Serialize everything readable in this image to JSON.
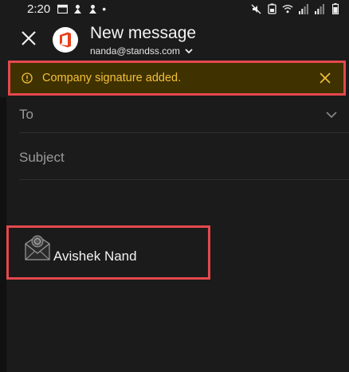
{
  "status_bar": {
    "time": "2:20",
    "dot": "•",
    "left_icons": [
      "calendar-icon",
      "notification-icon",
      "notification-icon",
      "dot"
    ],
    "right_icons": [
      "mute-icon",
      "data-saver-icon",
      "wifi-icon",
      "signal-icon",
      "signal-icon",
      "battery-icon"
    ]
  },
  "header": {
    "close_icon": "close-icon",
    "title": "New message",
    "account": "nanda@standss.com",
    "account_chevron": "chevron-down-icon"
  },
  "banner": {
    "text": "Company signature added.",
    "icon": "info-icon",
    "close_icon": "close-icon",
    "text_color": "#f3c13a",
    "background_color": "#3f3100"
  },
  "fields": {
    "to_label": "To",
    "subject_label": "Subject"
  },
  "signature": {
    "name": "Avishek Nand",
    "logo": "envelope-seal-icon"
  },
  "colors": {
    "background": "#1b1b1b",
    "highlight_border": "#e5484d",
    "office_red": "#e8401c"
  }
}
